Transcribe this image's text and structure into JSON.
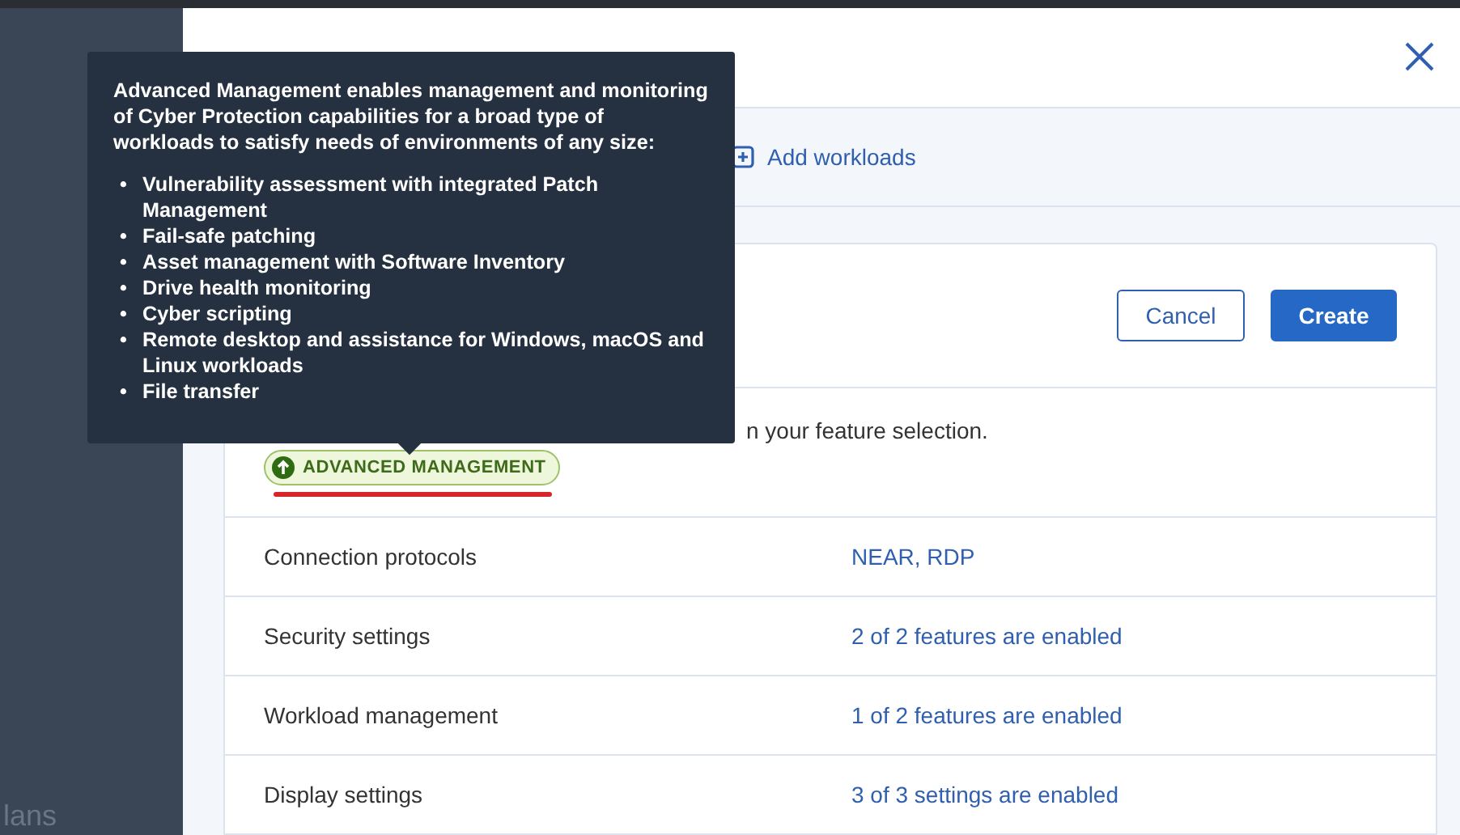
{
  "sidebar": {
    "partial_label": "lans"
  },
  "toolbar": {
    "add_link": "Add workloads"
  },
  "card": {
    "buttons": [
      {
        "kind": "secondary",
        "label": "Cancel"
      },
      {
        "kind": "primary",
        "label": "Create"
      }
    ],
    "notice": "n your feature selection.",
    "badge": {
      "label": "ADVANCED MANAGEMENT",
      "underlined": true
    },
    "rows": [
      {
        "label": "Connection protocols",
        "value": "NEAR, RDP"
      },
      {
        "label": "Security settings",
        "value": "2 of 2 features are enabled"
      },
      {
        "label": "Workload management",
        "value": "1 of 2 features are enabled"
      },
      {
        "label": "Display settings",
        "value": "3 of 3 settings are enabled"
      }
    ]
  },
  "tooltip": {
    "intro": "Advanced Management enables management and monitoring of Cyber Protection capabilities for a broad type of workloads to satisfy needs of environments of any size:",
    "marker": "•",
    "items": [
      "Vulnerability assessment with integrated Patch Management",
      "Fail-safe patching",
      "Asset management with Software Inventory",
      "Drive health monitoring",
      "Cyber scripting",
      "Remote desktop and assistance for Windows, macOS and Linux workloads",
      "File transfer"
    ]
  }
}
